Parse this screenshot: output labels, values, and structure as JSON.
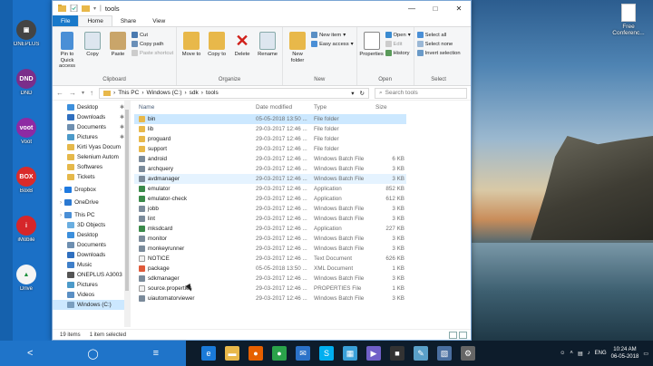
{
  "window": {
    "title": "tools",
    "tabs": [
      "File",
      "Home",
      "Share",
      "View"
    ],
    "controls": {
      "minimize": "—",
      "maximize": "□",
      "close": "✕"
    }
  },
  "ribbon": {
    "clipboard": {
      "name": "Clipboard",
      "pin": "Pin to Quick access",
      "copy": "Copy",
      "paste": "Paste",
      "cut": "Cut",
      "copy_path": "Copy path",
      "paste_shortcut": "Paste shortcut"
    },
    "organize": {
      "name": "Organize",
      "move_to": "Move to",
      "copy_to": "Copy to",
      "delete": "Delete",
      "rename": "Rename"
    },
    "new": {
      "name": "New",
      "new_folder": "New folder",
      "new_item": "New item",
      "easy_access": "Easy access"
    },
    "open": {
      "name": "Open",
      "properties": "Properties",
      "open": "Open",
      "edit": "Edit",
      "history": "History"
    },
    "select": {
      "name": "Select",
      "select_all": "Select all",
      "select_none": "Select none",
      "invert": "Invert selection"
    }
  },
  "address": {
    "breadcrumbs": [
      "This PC",
      "Windows (C:)",
      "sdk",
      "tools"
    ],
    "search_placeholder": "Search tools"
  },
  "columns": {
    "name": "Name",
    "date": "Date modified",
    "type": "Type",
    "size": "Size"
  },
  "navpane": [
    {
      "label": "Desktop",
      "pinned": true,
      "level": 1,
      "color": "#3c8fdc"
    },
    {
      "label": "Downloads",
      "pinned": true,
      "level": 1,
      "color": "#2f6fbf"
    },
    {
      "label": "Documents",
      "pinned": true,
      "level": 1,
      "color": "#6e8fb0"
    },
    {
      "label": "Pictures",
      "pinned": true,
      "level": 1,
      "color": "#4c9ac9"
    },
    {
      "label": "Kirti Vyas Docum",
      "pinned": false,
      "level": 1,
      "color": "#e5b84a"
    },
    {
      "label": "Selenium Autom",
      "pinned": false,
      "level": 1,
      "color": "#e5b84a"
    },
    {
      "label": "Softwares",
      "pinned": false,
      "level": 1,
      "color": "#e5b84a"
    },
    {
      "label": "Tickets",
      "pinned": false,
      "level": 1,
      "color": "#e5b84a"
    },
    {
      "label": "Dropbox",
      "pinned": false,
      "level": 0,
      "color": "#1f7ae0"
    },
    {
      "label": "OneDrive",
      "pinned": false,
      "level": 0,
      "color": "#2b79d1"
    },
    {
      "label": "This PC",
      "pinned": false,
      "level": 0,
      "color": "#4a8fd6"
    },
    {
      "label": "3D Objects",
      "pinned": false,
      "level": 1,
      "color": "#6aaee0"
    },
    {
      "label": "Desktop",
      "pinned": false,
      "level": 1,
      "color": "#3c8fdc"
    },
    {
      "label": "Documents",
      "pinned": false,
      "level": 1,
      "color": "#6e8fb0"
    },
    {
      "label": "Downloads",
      "pinned": false,
      "level": 1,
      "color": "#2f6fbf"
    },
    {
      "label": "Music",
      "pinned": false,
      "level": 1,
      "color": "#3f7fc9"
    },
    {
      "label": "ONEPLUS A3003",
      "pinned": false,
      "level": 1,
      "color": "#555555"
    },
    {
      "label": "Pictures",
      "pinned": false,
      "level": 1,
      "color": "#4c9ac9"
    },
    {
      "label": "Videos",
      "pinned": false,
      "level": 1,
      "color": "#5a8fc4"
    },
    {
      "label": "Windows (C:)",
      "pinned": false,
      "level": 1,
      "color": "#7a9ebf",
      "selected": true
    }
  ],
  "files": [
    {
      "name": "bin",
      "date": "05-05-2018 13:50 ...",
      "type": "File folder",
      "size": "",
      "kind": "folder",
      "selected": true
    },
    {
      "name": "lib",
      "date": "29-03-2017 12:46 ...",
      "type": "File folder",
      "size": "",
      "kind": "folder"
    },
    {
      "name": "proguard",
      "date": "29-03-2017 12:46 ...",
      "type": "File folder",
      "size": "",
      "kind": "folder"
    },
    {
      "name": "support",
      "date": "29-03-2017 12:46 ...",
      "type": "File folder",
      "size": "",
      "kind": "folder"
    },
    {
      "name": "android",
      "date": "29-03-2017 12:46 ...",
      "type": "Windows Batch File",
      "size": "6 KB",
      "kind": "bat"
    },
    {
      "name": "archquery",
      "date": "29-03-2017 12:46 ...",
      "type": "Windows Batch File",
      "size": "3 KB",
      "kind": "bat"
    },
    {
      "name": "avdmanager",
      "date": "29-03-2017 12:46 ...",
      "type": "Windows Batch File",
      "size": "3 KB",
      "kind": "bat",
      "hover": true
    },
    {
      "name": "emulator",
      "date": "29-03-2017 12:46 ...",
      "type": "Application",
      "size": "852 KB",
      "kind": "app"
    },
    {
      "name": "emulator-check",
      "date": "29-03-2017 12:46 ...",
      "type": "Application",
      "size": "612 KB",
      "kind": "app"
    },
    {
      "name": "jobb",
      "date": "29-03-2017 12:46 ...",
      "type": "Windows Batch File",
      "size": "3 KB",
      "kind": "bat"
    },
    {
      "name": "lint",
      "date": "29-03-2017 12:46 ...",
      "type": "Windows Batch File",
      "size": "3 KB",
      "kind": "bat"
    },
    {
      "name": "mksdcard",
      "date": "29-03-2017 12:46 ...",
      "type": "Application",
      "size": "227 KB",
      "kind": "app"
    },
    {
      "name": "monitor",
      "date": "29-03-2017 12:46 ...",
      "type": "Windows Batch File",
      "size": "3 KB",
      "kind": "bat"
    },
    {
      "name": "monkeyrunner",
      "date": "29-03-2017 12:46 ...",
      "type": "Windows Batch File",
      "size": "3 KB",
      "kind": "bat"
    },
    {
      "name": "NOTICE",
      "date": "29-03-2017 12:46 ...",
      "type": "Text Document",
      "size": "626 KB",
      "kind": "txt"
    },
    {
      "name": "package",
      "date": "05-05-2018 13:50 ...",
      "type": "XML Document",
      "size": "1 KB",
      "kind": "xml"
    },
    {
      "name": "sdkmanager",
      "date": "29-03-2017 12:46 ...",
      "type": "Windows Batch File",
      "size": "3 KB",
      "kind": "bat"
    },
    {
      "name": "source.properties",
      "date": "29-03-2017 12:46 ...",
      "type": "PROPERTIES File",
      "size": "1 KB",
      "kind": "txt"
    },
    {
      "name": "uiautomatorviewer",
      "date": "29-03-2017 12:46 ...",
      "type": "Windows Batch File",
      "size": "3 KB",
      "kind": "bat"
    }
  ],
  "status": {
    "count": "19 items",
    "selected": "1 item selected"
  },
  "desktop_icons": [
    {
      "label": "ONEPLUS",
      "color": "#444444",
      "glyph": "▣"
    },
    {
      "label": "DND",
      "color": "#7b2e8a",
      "glyph": "DND"
    },
    {
      "label": "Voot",
      "color": "#8e2aa3",
      "glyph": "voot"
    },
    {
      "label": "BoxB",
      "color": "#d92b2b",
      "glyph": "BOX"
    },
    {
      "label": "iMobile",
      "color": "#d6262a",
      "glyph": "i"
    },
    {
      "label": "Drive",
      "color": "#f4f4f4",
      "glyph": "▲"
    }
  ],
  "desktop_right": {
    "label": "Free Conferenc..."
  },
  "taskbar": {
    "nav": {
      "back": "<",
      "home": "◯",
      "menu": "≡"
    },
    "apps": [
      {
        "name": "edge-icon",
        "color": "#1a7ad8",
        "glyph": "e"
      },
      {
        "name": "file-explorer-icon",
        "color": "#e8b84a",
        "glyph": "▬"
      },
      {
        "name": "firefox-icon",
        "color": "#e66000",
        "glyph": "●"
      },
      {
        "name": "chrome-icon",
        "color": "#2aa34a",
        "glyph": "●"
      },
      {
        "name": "mail-icon",
        "color": "#2b72c8",
        "glyph": "✉"
      },
      {
        "name": "skype-icon",
        "color": "#00aff0",
        "glyph": "S"
      },
      {
        "name": "store-icon",
        "color": "#3aa0d8",
        "glyph": "▦"
      },
      {
        "name": "media-icon",
        "color": "#7060c8",
        "glyph": "▶"
      },
      {
        "name": "terminal-icon",
        "color": "#333333",
        "glyph": "■"
      },
      {
        "name": "notepad-icon",
        "color": "#5aa0c8",
        "glyph": "✎"
      },
      {
        "name": "photos-icon",
        "color": "#4a6fa0",
        "glyph": "▧"
      },
      {
        "name": "settings-app-icon",
        "color": "#666666",
        "glyph": "⚙"
      }
    ],
    "lang": "ENG",
    "time": "10:24 AM",
    "date": "06-05-2018"
  }
}
